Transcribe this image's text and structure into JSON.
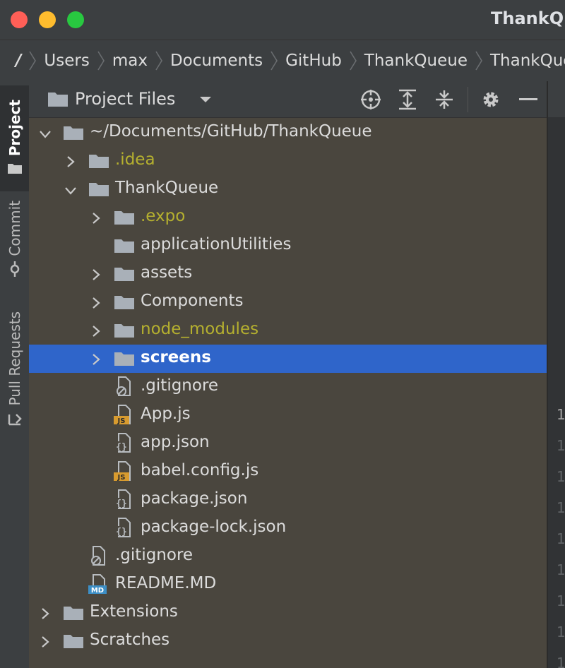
{
  "window": {
    "title": "ThankQu"
  },
  "breadcrumb": [
    "/",
    "Users",
    "max",
    "Documents",
    "GitHub",
    "ThankQueue",
    "ThankQueue"
  ],
  "tool_stripe": {
    "tabs": [
      {
        "label": "Project",
        "icon": "folder-icon",
        "active": true
      },
      {
        "label": "Commit",
        "icon": "commit-icon",
        "active": false
      },
      {
        "label": "Pull Requests",
        "icon": "pull-request-icon",
        "active": false
      }
    ]
  },
  "project_panel": {
    "title": "Project Files",
    "toolbar_icons": [
      "locate-icon",
      "expand-all-icon",
      "collapse-all-icon",
      "gear-icon",
      "hide-icon"
    ]
  },
  "tree": [
    {
      "label": "~/Documents/GitHub/ThankQueue",
      "kind": "folder",
      "expanded": true,
      "ignored": false,
      "depth": 0
    },
    {
      "label": ".idea",
      "kind": "folder",
      "expanded": false,
      "ignored": true,
      "depth": 1
    },
    {
      "label": "ThankQueue",
      "kind": "folder",
      "expanded": true,
      "ignored": false,
      "depth": 1
    },
    {
      "label": ".expo",
      "kind": "folder",
      "expanded": false,
      "ignored": true,
      "depth": 2
    },
    {
      "label": "applicationUtilities",
      "kind": "folder",
      "expanded": null,
      "ignored": false,
      "depth": 2
    },
    {
      "label": "assets",
      "kind": "folder",
      "expanded": false,
      "ignored": false,
      "depth": 2
    },
    {
      "label": "Components",
      "kind": "folder",
      "expanded": false,
      "ignored": false,
      "depth": 2
    },
    {
      "label": "node_modules",
      "kind": "folder",
      "expanded": false,
      "ignored": true,
      "depth": 2
    },
    {
      "label": "screens",
      "kind": "folder",
      "expanded": false,
      "ignored": false,
      "selected": true,
      "depth": 2
    },
    {
      "label": ".gitignore",
      "kind": "gitignore",
      "depth": 2
    },
    {
      "label": "App.js",
      "kind": "js",
      "depth": 2
    },
    {
      "label": "app.json",
      "kind": "json",
      "depth": 2
    },
    {
      "label": "babel.config.js",
      "kind": "js",
      "depth": 2
    },
    {
      "label": "package.json",
      "kind": "json",
      "depth": 2
    },
    {
      "label": "package-lock.json",
      "kind": "json",
      "depth": 2
    },
    {
      "label": ".gitignore",
      "kind": "gitignore",
      "depth": 1
    },
    {
      "label": "README.MD",
      "kind": "md",
      "depth": 1
    },
    {
      "label": "Extensions",
      "kind": "folder",
      "expanded": false,
      "ignored": false,
      "depth": 0
    },
    {
      "label": "Scratches",
      "kind": "folder",
      "expanded": false,
      "ignored": false,
      "depth": 0
    }
  ],
  "editor": {
    "line_numbers": [
      "1",
      "1",
      "1",
      "1",
      "1",
      "1",
      "1",
      "1",
      "1"
    ]
  },
  "colors": {
    "selection": "#2f65ca",
    "ignored_text": "#b5b02f",
    "panel_bg": "#4a463e"
  }
}
